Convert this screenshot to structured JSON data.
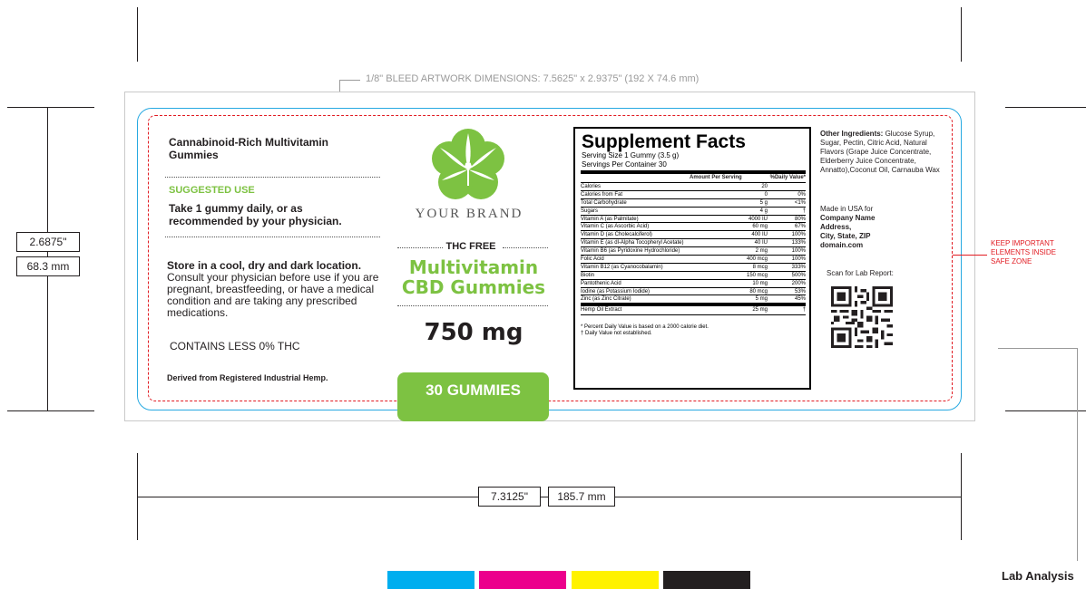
{
  "dimensions": {
    "bleed_title": "1/8\" BLEED ARTWORK DIMENSIONS:  7.5625\" x 2.9375\" (192 X 74.6 mm)",
    "height_in": "2.6875\"",
    "height_mm": "68.3 mm",
    "width_in": "7.3125\"",
    "width_mm": "185.7 mm"
  },
  "safe_zone_note": [
    "KEEP IMPORTANT",
    "ELEMENTS INSIDE",
    "SAFE ZONE"
  ],
  "left_panel": {
    "product_title": "Cannabinoid-Rich Multivitamin Gummies",
    "suggested_use_heading": "SUGGESTED USE",
    "suggested_use_text": "Take 1 gummy daily, or as recommended by your physician.",
    "storage_heading": "Store in a cool, dry and dark location.",
    "storage_text": "Consult your physician before use if you are pregnant, breastfeeding, or have a medical condition and are taking any prescribed medications.",
    "thc_note": "CONTAINS LESS 0% THC",
    "derived": "Derived from Registered Industrial Hemp."
  },
  "center_panel": {
    "brand": "YOUR BRAND",
    "thc_free": "THC FREE",
    "product_line1": "Multivitamin",
    "product_line2": "CBD Gummies",
    "strength": "750 mg",
    "count_badge": "30 GUMMIES",
    "logo_icon": "cannabis-leaf-flower-icon"
  },
  "supplement_facts": {
    "title": "Supplement Facts",
    "serving_size": "Serving Size 1 Gummy (3.5 g)",
    "servings_per_container": "Servings Per Container 30",
    "col_amount": "Amount Per Serving",
    "col_dv": "%Daily Value*",
    "rows": [
      {
        "name": "Calories",
        "amount": "20",
        "dv": ""
      },
      {
        "name": "Calories from Fat",
        "amount": "0",
        "dv": "0%"
      },
      {
        "name": "Total Carbohydrate",
        "amount": "5 g",
        "dv": "<1%"
      },
      {
        "name": "  Sugars",
        "amount": "4 g",
        "dv": "†"
      },
      {
        "name": "Vitamin A (as Palmitate)",
        "amount": "4000 IU",
        "dv": "80%"
      },
      {
        "name": "Vitamin C (as Ascorbic Acid)",
        "amount": "60 mg",
        "dv": "67%"
      },
      {
        "name": "Vitamin D (as Cholecalciferol)",
        "amount": "400 IU",
        "dv": "100%"
      },
      {
        "name": "Vitamin E (as dl-Alpha Tocopheryl Acetate)",
        "amount": "40 IU",
        "dv": "133%"
      },
      {
        "name": "Vitamin B6 (as Pyridoxine Hydrochloride)",
        "amount": "2 mg",
        "dv": "100%"
      },
      {
        "name": "Folic Acid",
        "amount": "400 mcg",
        "dv": "100%"
      },
      {
        "name": "Vitamin B12 (as Cyanocobalamin)",
        "amount": "8 mcg",
        "dv": "333%"
      },
      {
        "name": "Biotin",
        "amount": "150 mcg",
        "dv": "500%"
      },
      {
        "name": "Pantothenic Acid",
        "amount": "10 mg",
        "dv": "200%"
      },
      {
        "name": "Iodine (as Potassium Iodide)",
        "amount": "80 mcg",
        "dv": "53%"
      },
      {
        "name": "Zinc (as Zinc Citrate)",
        "amount": "5 mg",
        "dv": "45%"
      }
    ],
    "hemp_row": {
      "name": "Hemp Oil Extract",
      "amount": "25 mg",
      "dv": "†"
    },
    "footnote1": "* Percent Daily Value is based on a 2000 calorie diet.",
    "footnote2": "† Daily Value not established."
  },
  "right_panel": {
    "other_ingredients_label": "Other Ingredients:",
    "other_ingredients_text": "Glucose Syrup, Sugar, Pectin, Citric Acid, Natural Flavors (Grape Juice Concentrate, Elderberry Juice Concentrate, Annatto),Coconut Oil, Carnauba Wax",
    "made_in": "Made in USA for",
    "company": "Company Name",
    "address": "Address,",
    "city": "City, State, ZIP",
    "domain": "domain.com",
    "scan": "Scan for Lab Report:",
    "qr_icon": "qr-code-icon"
  },
  "lab_analysis": "Lab Analysis",
  "colors": {
    "brand_green": "#7dc242",
    "bleed_blue": "#27a9e1",
    "safe_red": "#e11b22",
    "cyan": "#00aeef",
    "magenta": "#ec008c",
    "yellow": "#fff200",
    "black": "#231f20"
  }
}
